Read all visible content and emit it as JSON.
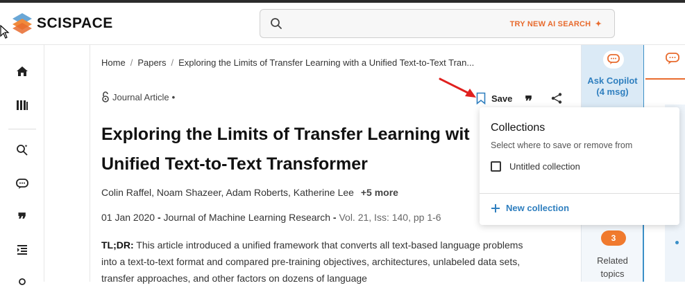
{
  "app": {
    "name": "SCISPACE"
  },
  "search": {
    "cta": "TRY NEW AI SEARCH"
  },
  "breadcrumb": {
    "items": [
      "Home",
      "Papers",
      "Exploring the Limits of Transfer Learning with a Unified Text-to-Text Tran..."
    ]
  },
  "article": {
    "type": "Journal Article",
    "type_suffix": "•",
    "title": "Exploring the Limits of Transfer Learning with a Unified Text-to-Text Transformer",
    "title_visible": "Exploring the Limits of Transfer Learning wit",
    "title_line2": "Unified Text-to-Text Transformer",
    "authors": "Colin Raffel, Noam Shazeer, Adam Roberts, Katherine Lee",
    "authors_more": "+5 more",
    "date": "01 Jan 2020",
    "journal": "Journal of Machine Learning Research",
    "volume": "Vol. 21, Iss: 140, pp 1-6",
    "tldr_label": "TL;DR:",
    "tldr_text": "This article introduced a unified framework that converts all text-based language problems into a text-to-text format and compared pre-training objectives, architectures, unlabeled data sets, transfer approaches, and other factors on dozens of language"
  },
  "actions": {
    "save_label": "Save"
  },
  "copilot": {
    "label_line1": "Ask Copilot",
    "label_line2": "(4 msg)",
    "related_count": "3",
    "related_line1": "Related",
    "related_line2": "topics"
  },
  "collections": {
    "title": "Collections",
    "subtitle": "Select where to save or remove from",
    "items": [
      {
        "label": "Untitled collection",
        "checked": false
      }
    ],
    "new_label": "New collection"
  },
  "colors": {
    "brand_orange": "#e86b2e",
    "brand_blue": "#2f7fbf",
    "annotation_red": "#e0201e"
  },
  "icons": [
    "home-icon",
    "library-icon",
    "search-doc-icon",
    "chat-icon",
    "quote-icon",
    "outline-icon",
    "bookmark-icon",
    "share-icon",
    "open-access-icon",
    "plus-icon"
  ]
}
